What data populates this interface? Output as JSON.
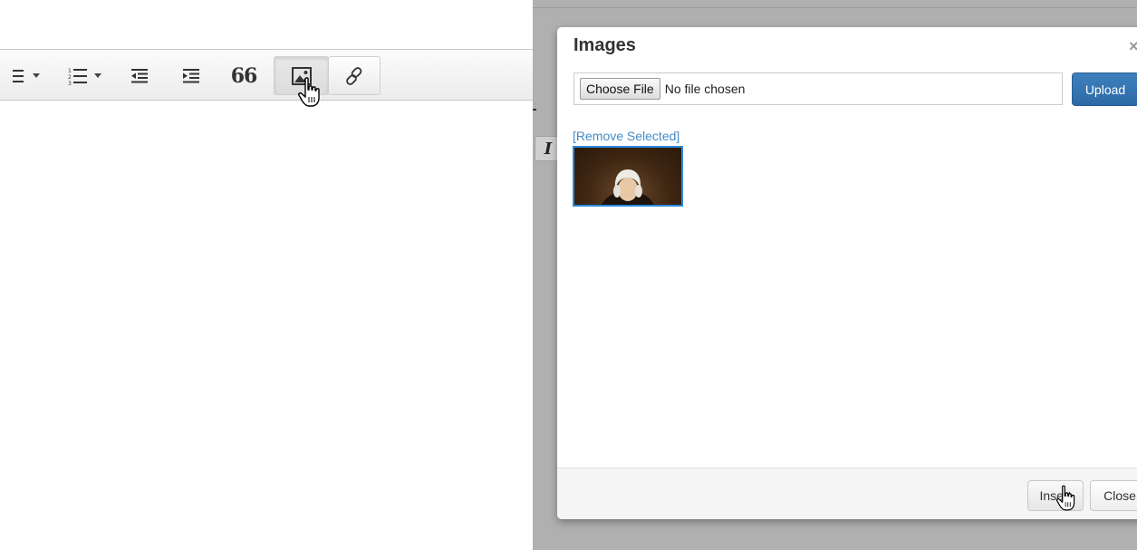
{
  "toolbar": {
    "buttons": [
      {
        "icon": "unordered-list-icon",
        "has_dropdown": true
      },
      {
        "icon": "ordered-list-icon",
        "has_dropdown": true
      },
      {
        "icon": "outdent-icon"
      },
      {
        "icon": "indent-icon"
      },
      {
        "icon": "blockquote-icon",
        "glyph": "66"
      },
      {
        "icon": "image-icon",
        "state": "hovered"
      },
      {
        "icon": "link-icon"
      }
    ]
  },
  "background_editor": {
    "italic_label": "I"
  },
  "modal": {
    "title": "Images",
    "close_glyph": "×",
    "file_input": {
      "button_label": "Choose File",
      "status": "No file chosen"
    },
    "upload_label": "Upload",
    "remove_selected_label": "[Remove Selected]",
    "images": [
      {
        "name": "portrait-thumbnail",
        "selected": true
      }
    ],
    "footer": {
      "insert_label": "Insert",
      "close_label": "Close"
    }
  },
  "colors": {
    "overlay": "#b0b0b0",
    "primary_button": "#337ab7",
    "link": "#428bca",
    "selection_border": "#2b8ae0"
  }
}
